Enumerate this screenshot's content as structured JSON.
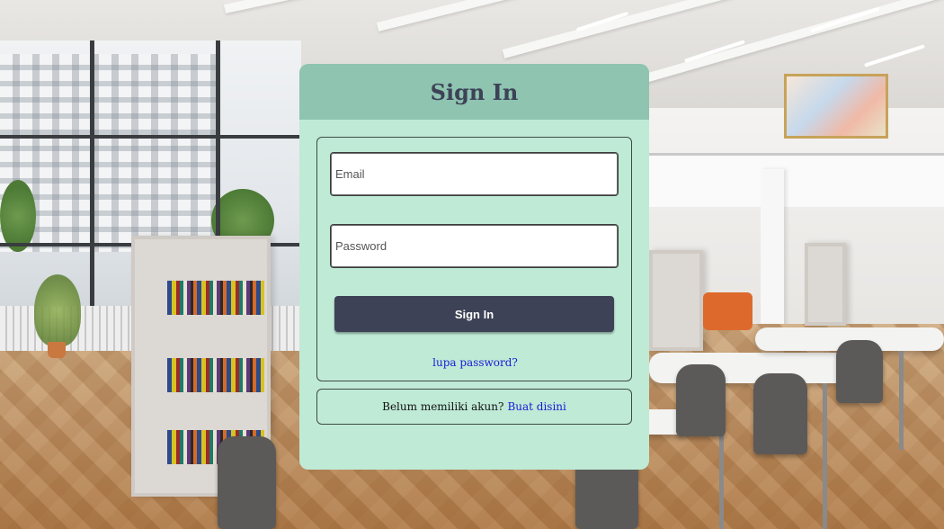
{
  "card": {
    "title": "Sign In"
  },
  "form": {
    "email_placeholder": "Email",
    "password_placeholder": "Password",
    "submit_label": "Sign In",
    "forgot_password_link": "lupa password?"
  },
  "register": {
    "prompt": "Belum memiliki akun?",
    "link_label": "Buat disini"
  },
  "colors": {
    "card_background": "#bfead6",
    "header_background": "#8ec4b0",
    "title_text": "#3d4257",
    "button_background": "#3e4256",
    "link": "#1a1ad6"
  }
}
